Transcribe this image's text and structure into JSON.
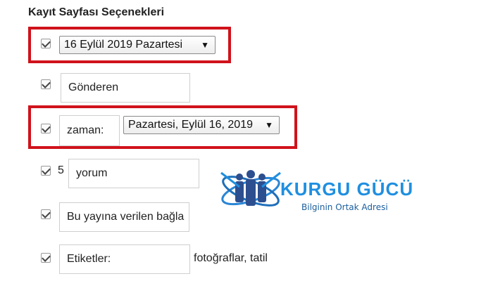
{
  "section": {
    "title": "Kayıt Sayfası Seçenekleri"
  },
  "rows": {
    "date_select": "16 Eylül 2019 Pazartesi",
    "sender_field": "Gönderen",
    "time_label": "zaman:",
    "time_select": "Pazartesi, Eylül 16, 2019",
    "comments_count": "5",
    "comments_field": "yorum",
    "backlink_field": "Bu yayına verilen bağla",
    "tags_field": "Etiketler:",
    "tags_values": "fotoğraflar, tatil"
  },
  "watermark": {
    "brand": "KURGU GÜCÜ",
    "tagline": "Bilginin Ortak Adresi"
  },
  "colors": {
    "highlight": "#d0121b",
    "brand": "#1f8fe0"
  },
  "icons": [
    "checkbox-checked-icon",
    "dropdown-caret-icon",
    "people-orbit-logo-icon"
  ]
}
